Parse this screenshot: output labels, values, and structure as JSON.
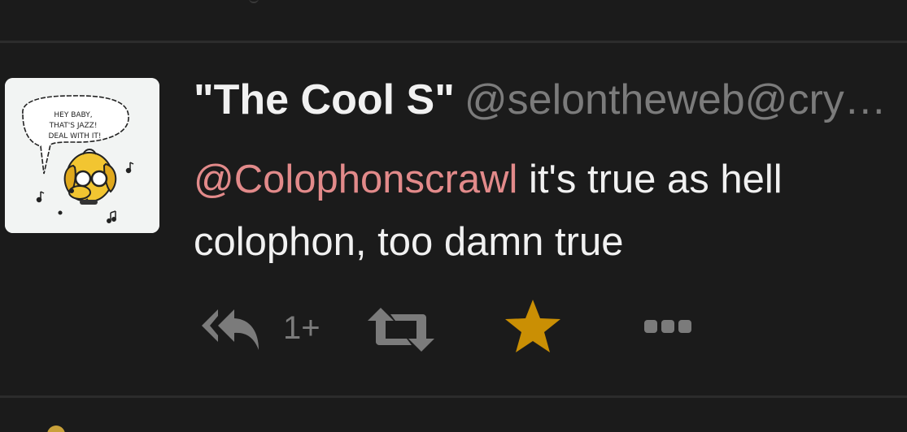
{
  "status": {
    "display_name": "\"The Cool S\"",
    "account": "@selontheweb@cry…",
    "content": {
      "mention": "@Colophonscrawl",
      "line1_rest": " it's true as hell",
      "line2": "colophon, too damn true"
    },
    "avatar": {
      "speech_text": [
        "HEY BABY,",
        "THAT'S JAZZ!",
        "DEAL WITH IT!"
      ]
    },
    "actions": {
      "reply_count": "1+",
      "reply_icon": "reply-all-icon",
      "boost_icon": "retweet-icon",
      "favourite_icon": "star-icon",
      "more_icon": "ellipsis-icon",
      "favourited": true
    }
  },
  "colors": {
    "background": "#1b1b1b",
    "divider": "#2c2c2c",
    "text": "#f1f1f1",
    "muted": "#7b7b7b",
    "mention": "#e28a8a",
    "favourite": "#ca8f04"
  }
}
